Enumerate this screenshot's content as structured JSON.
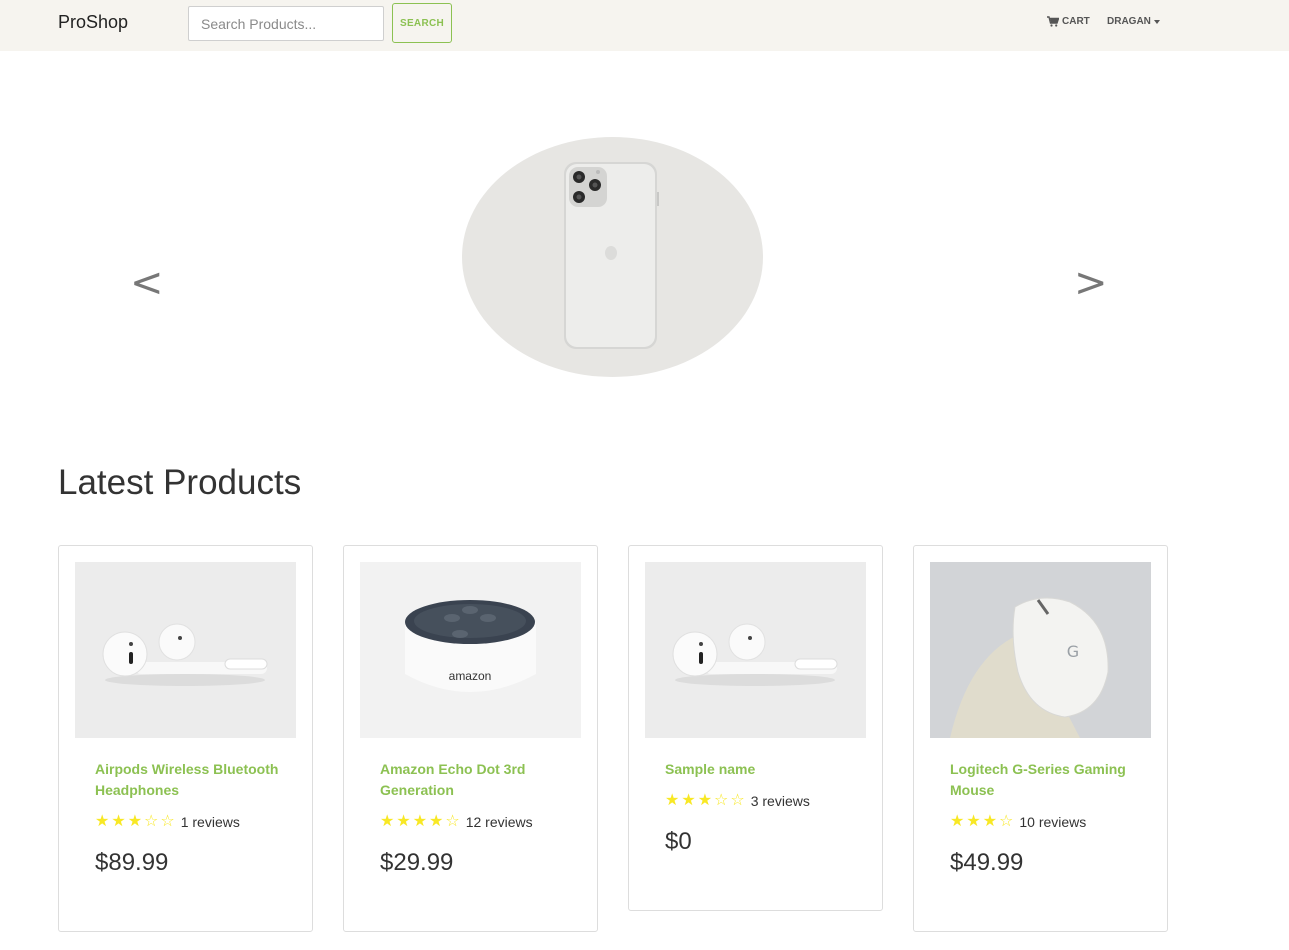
{
  "navbar": {
    "brand": "ProShop",
    "search_placeholder": "Search Products...",
    "search_button": "SEARCH",
    "cart_label": "CART",
    "user_label": "DRAGAN",
    "icons": {
      "cart": "cart-icon",
      "user_menu": "caret-down-icon"
    }
  },
  "carousel": {
    "prev": "<",
    "next": ">",
    "image": "iphone-silver-back"
  },
  "section_title": "Latest Products",
  "colors": {
    "accent": "#8cc152",
    "star": "#f8e825",
    "navbar_bg": "#f6f4ef"
  },
  "products": [
    {
      "name": "Airpods Wireless Bluetooth Headphones",
      "rating": 2.5,
      "rating_max": 5,
      "reviews": "1 reviews",
      "price": "$89.99",
      "image": "airpods"
    },
    {
      "name": "Amazon Echo Dot 3rd Generation",
      "rating": 4,
      "rating_max": 5,
      "reviews": "12 reviews",
      "price": "$29.99",
      "image": "echo-dot"
    },
    {
      "name": "Sample name",
      "rating": 3,
      "rating_max": 5,
      "reviews": "3 reviews",
      "price": "$0",
      "image": "airpods"
    },
    {
      "name": "Logitech G-Series Gaming Mouse",
      "rating": 3,
      "rating_max": 5,
      "reviews": "10 reviews",
      "price": "$49.99",
      "image": "gaming-mouse"
    }
  ]
}
